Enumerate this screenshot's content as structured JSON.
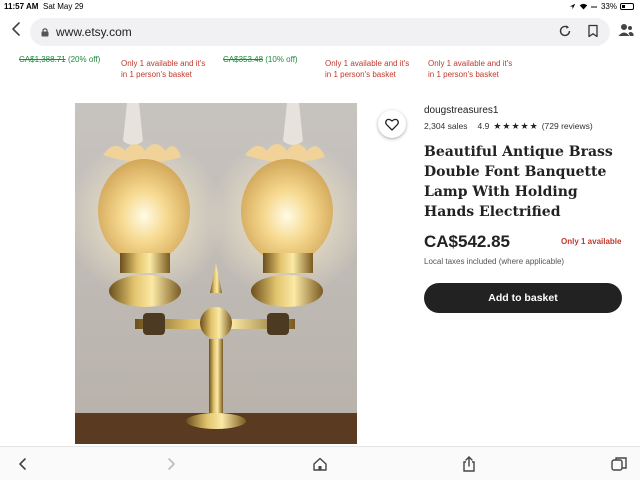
{
  "status": {
    "time": "11:57 AM",
    "date": "Sat May 29",
    "battery": "33%",
    "battery_level": 0.33
  },
  "browser": {
    "url": "www.etsy.com",
    "icons": [
      "back-icon",
      "lock-icon",
      "reload-icon",
      "bookmark-icon",
      "account-icon"
    ]
  },
  "strip": {
    "item1": {
      "old_price": "CA$1,388.71",
      "discount": "(20% off)"
    },
    "item2": {
      "availability_line1": "Only 1 available and it's",
      "availability_line2": "in 1 person's basket"
    },
    "item3": {
      "old_price": "CA$353.48",
      "discount": "(10% off)"
    },
    "item4": {
      "availability_line1": "Only 1 available and it's",
      "availability_line2": "in 1 person's basket"
    },
    "item5": {
      "availability_line1": "Only 1 available and it's",
      "availability_line2": "in 1 person's basket"
    }
  },
  "product": {
    "shop": "dougstreasures1",
    "sales": "2,304 sales",
    "rating": "4.9",
    "rating_stars": 5,
    "reviews": "(729 reviews)",
    "title": "Beautiful Antique Brass Double Font Banquette Lamp With Holding Hands Electrified",
    "price": "CA$542.85",
    "availability": "Only 1 available",
    "tax_note": "Local taxes included (where applicable)",
    "add_to_basket": "Add to basket"
  },
  "colors": {
    "accent_green": "#1e8a3e",
    "alert_red": "#c0392b",
    "button_dark": "#222222"
  },
  "toolbar": {
    "icons": [
      "back-icon",
      "forward-icon",
      "home-icon",
      "share-icon",
      "tabs-icon"
    ]
  }
}
